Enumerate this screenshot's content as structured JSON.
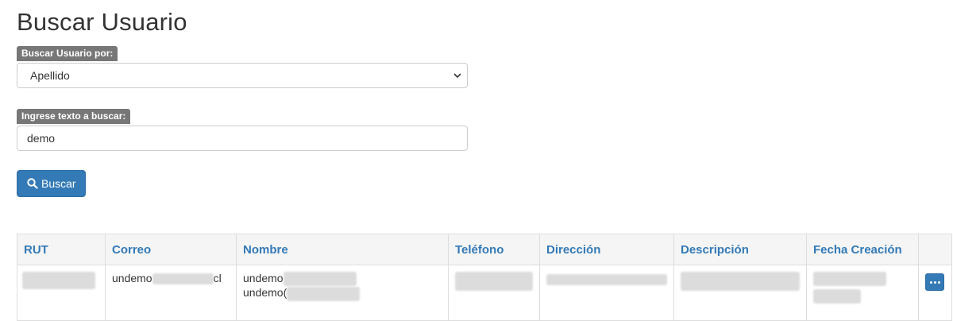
{
  "page": {
    "title": "Buscar Usuario"
  },
  "search_by": {
    "label": "Buscar Usuario por:",
    "selected": "Apellido"
  },
  "query": {
    "label": "Ingrese texto a buscar:",
    "value": "demo"
  },
  "search_button": {
    "label": "Buscar"
  },
  "table": {
    "headers": [
      "RUT",
      "Correo",
      "Nombre",
      "Teléfono",
      "Dirección",
      "Descripción",
      "Fecha Creación",
      ""
    ],
    "rows": [
      {
        "correo_prefix": "undemo",
        "correo_suffix": "cl",
        "nombre_line1": "undemo",
        "nombre_line2": "undemo("
      }
    ]
  },
  "colors": {
    "accent": "#337ab7",
    "label_bg": "#777777",
    "header_bg": "#f5f5f5"
  },
  "icons": {
    "search": "search-icon",
    "more": "ellipsis-icon",
    "select": "chevron-down-icon"
  }
}
